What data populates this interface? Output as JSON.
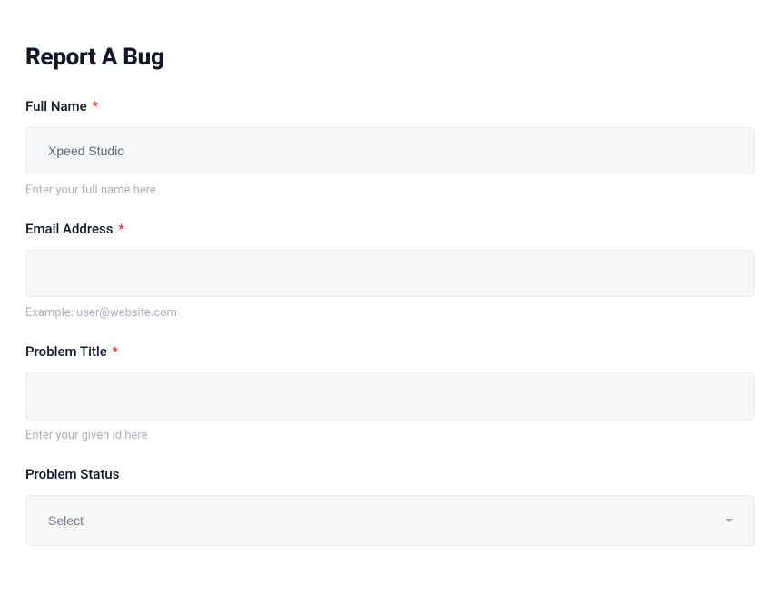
{
  "form": {
    "title": "Report A Bug",
    "fields": {
      "fullName": {
        "label": "Full Name",
        "required": true,
        "placeholder": "Xpeed Studio",
        "value": "",
        "help": "Enter your full name here"
      },
      "email": {
        "label": "Email Address",
        "required": true,
        "placeholder": "",
        "value": "",
        "help": "Example: user@website.com"
      },
      "problemTitle": {
        "label": "Problem Title",
        "required": true,
        "placeholder": "",
        "value": "",
        "help": "Enter your given id here"
      },
      "problemStatus": {
        "label": "Problem Status",
        "required": false,
        "selected": "Select"
      }
    },
    "requiredMark": "*"
  }
}
